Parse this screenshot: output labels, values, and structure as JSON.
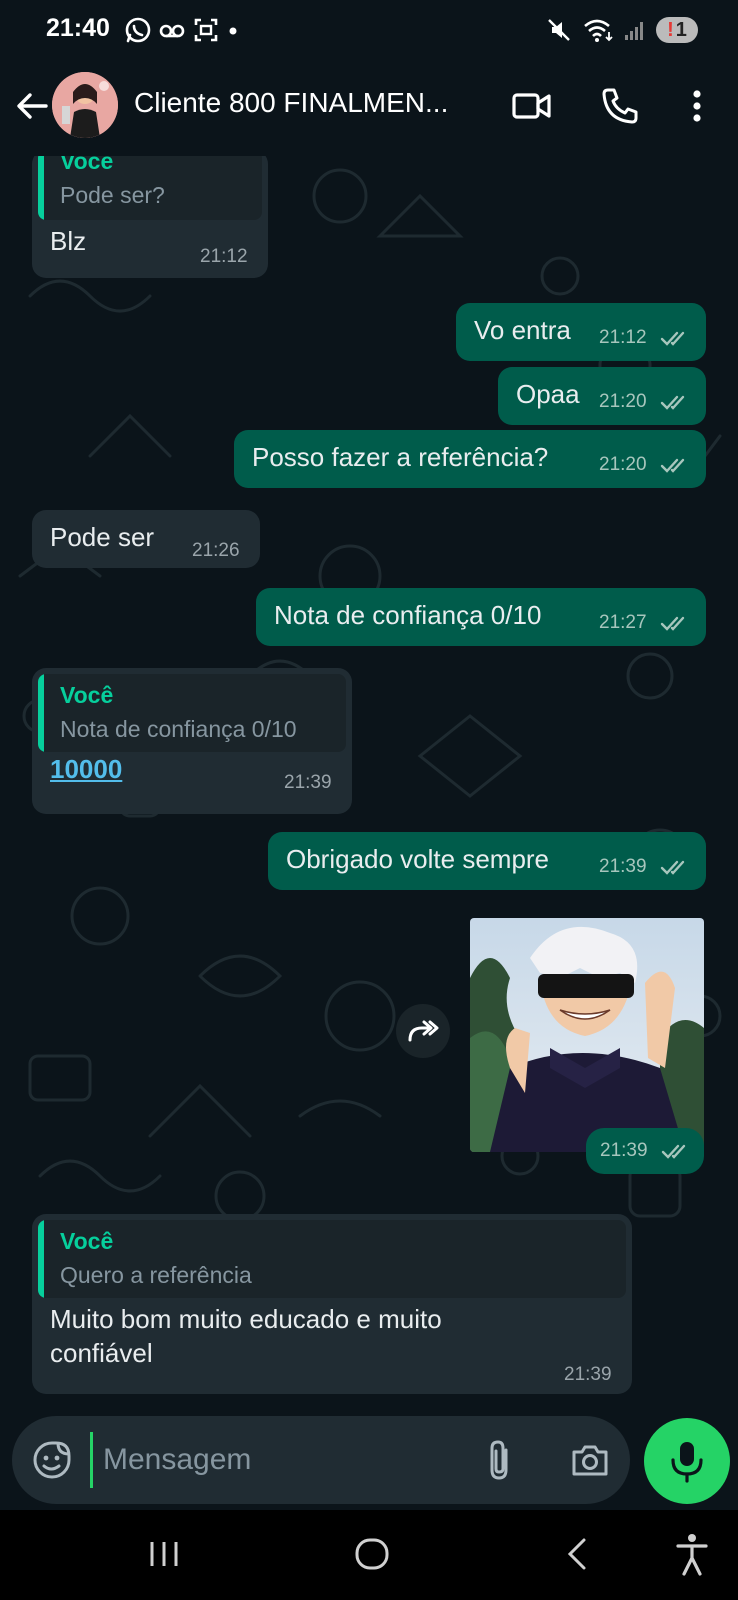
{
  "status_bar": {
    "time": "21:40",
    "battery_alert": "!",
    "battery_value": "1"
  },
  "header": {
    "contact_name": "Cliente 800 FINALMEN..."
  },
  "messages": [
    {
      "direction": "incoming",
      "quote_author": "Você",
      "quote_text": "Pode ser?",
      "text": "Blz",
      "time": "21:12"
    },
    {
      "direction": "outgoing",
      "text": "Vo entra",
      "time": "21:12",
      "status": "read"
    },
    {
      "direction": "outgoing",
      "text": "Opaa",
      "time": "21:20",
      "status": "read"
    },
    {
      "direction": "outgoing",
      "text": "Posso fazer a referência?",
      "time": "21:20",
      "status": "read"
    },
    {
      "direction": "incoming",
      "text": "Pode ser",
      "time": "21:26"
    },
    {
      "direction": "outgoing",
      "text": "Nota de confiança 0/10",
      "time": "21:27",
      "status": "read"
    },
    {
      "direction": "incoming",
      "quote_author": "Você",
      "quote_text": "Nota de confiança 0/10",
      "text": "10000",
      "time": "21:39"
    },
    {
      "direction": "outgoing",
      "text": "Obrigado volte sempre",
      "time": "21:39",
      "status": "read"
    },
    {
      "direction": "outgoing",
      "type": "image",
      "time": "21:39",
      "status": "read"
    },
    {
      "direction": "incoming",
      "quote_author": "Você",
      "quote_text": "Quero a referência",
      "text_line1": "Muito bom muito educado e muito",
      "text_line2": "confiável",
      "time": "21:39"
    }
  ],
  "composer": {
    "placeholder": "Mensagem"
  },
  "colors": {
    "background": "#0b141a",
    "incoming_bubble": "#202c33",
    "outgoing_bubble": "#005c4b",
    "accent": "#25d366",
    "quote_author": "#06cf9c",
    "link": "#53bdeb"
  },
  "icons": {
    "status_left": [
      "whatsapp-icon",
      "voicemail-icon",
      "screenshot-icon",
      "dot-icon"
    ],
    "status_right": [
      "mute-icon",
      "wifi-icon",
      "signal-icon",
      "battery-icon"
    ],
    "header": [
      "back-arrow-icon",
      "video-call-icon",
      "phone-icon",
      "more-vert-icon"
    ],
    "composer": [
      "sticker-icon",
      "attach-icon",
      "camera-icon",
      "mic-icon"
    ],
    "nav": [
      "recents-icon",
      "home-icon",
      "back-icon",
      "accessibility-icon"
    ]
  }
}
